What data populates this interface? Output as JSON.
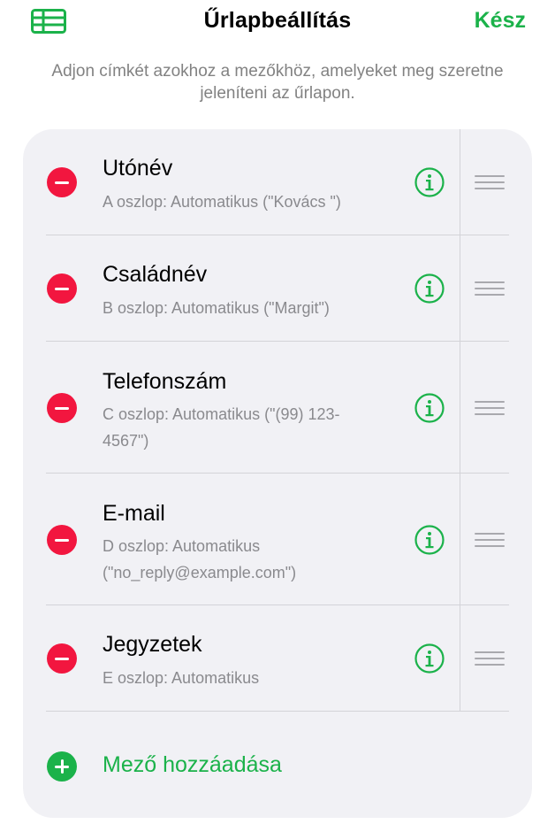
{
  "header": {
    "title": "Űrlapbeállítás",
    "done_label": "Kész",
    "left_icon": "table-icon",
    "accent_color": "#1bb24a"
  },
  "description": "Adjon címkét azokhoz a mezőkhöz, amelyeket meg szeretne jeleníteni az űrlapon.",
  "fields": [
    {
      "name": "Utónév",
      "detail": "A oszlop: Automatikus (\"Kovács \")"
    },
    {
      "name": "Családnév",
      "detail": "B oszlop: Automatikus (\"Margit\")"
    },
    {
      "name": "Telefonszám",
      "detail": "C oszlop: Automatikus (\"(99) 123-4567\")"
    },
    {
      "name": "E-mail",
      "detail": "D oszlop: Automatikus (\"no_reply@example.com\")"
    },
    {
      "name": "Jegyzetek",
      "detail": "E oszlop: Automatikus"
    }
  ],
  "add_field": {
    "label": "Mező hozzáadása"
  },
  "colors": {
    "delete": "#f2163f",
    "add": "#1bb24a",
    "info": "#1bb24a"
  }
}
